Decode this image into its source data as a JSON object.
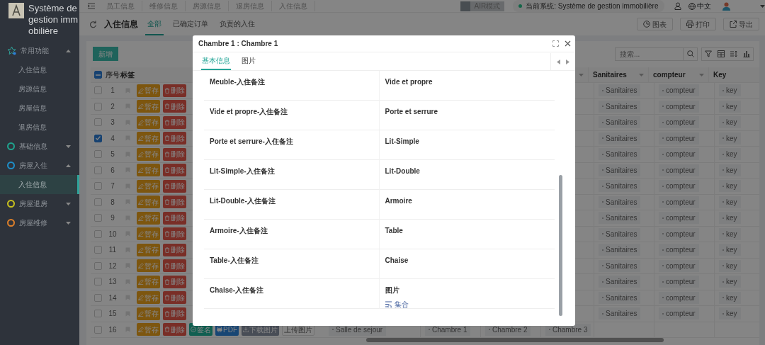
{
  "sidebar": {
    "title": "Système de gestion immobilière",
    "menu": [
      {
        "label": "常用功能",
        "kind": "star",
        "expanded": true,
        "children": [
          {
            "label": "入住信息",
            "selected": false
          },
          {
            "label": "房源信息",
            "selected": false
          },
          {
            "label": "房屋信息",
            "selected": false
          },
          {
            "label": "退房信息",
            "selected": false
          }
        ]
      },
      {
        "label": "基础信息",
        "kind": "ring",
        "color": "#1fa58f",
        "expanded": false
      },
      {
        "label": "房屋入住",
        "kind": "ring",
        "color": "#1e8fc9",
        "expanded": true,
        "children": [
          {
            "label": "入住信息",
            "selected": true
          }
        ]
      },
      {
        "label": "房屋退房",
        "kind": "ring",
        "color": "#c9c21e",
        "expanded": false
      },
      {
        "label": "房屋维修",
        "kind": "ring",
        "color": "#e0812a",
        "expanded": false
      }
    ]
  },
  "top_tabs": [
    "员工信息",
    "维修信息",
    "房源信息",
    "退房信息",
    "入住信息"
  ],
  "air_mode": {
    "label": "AIR模式",
    "on": false
  },
  "current_system": "当前系统: Système de gestion immobilière",
  "language": "中文",
  "page": {
    "title": "入住信息",
    "tabs": [
      {
        "label": "全部",
        "selected": true
      },
      {
        "label": "已确定订单",
        "selected": false
      },
      {
        "label": "负责的入住",
        "selected": false
      }
    ],
    "actions": [
      "图表",
      "打印",
      "导出"
    ]
  },
  "toolbar": {
    "add": "新增",
    "search_placeholder": "搜索..."
  },
  "table": {
    "select_all_partial": true,
    "header_left": [
      "序号",
      "标签"
    ],
    "header_right": [
      {
        "label": "Sanitaires",
        "filter": true
      },
      {
        "label": "compteur",
        "filter": true
      },
      {
        "label": "Key",
        "filter": false
      }
    ],
    "rows": [
      {
        "number": "1",
        "checked": false,
        "actions": [
          {
            "kind": "save",
            "label": "暂存"
          },
          {
            "kind": "delete",
            "label": "删除"
          }
        ],
        "right_tags": [
          "Sanitaires",
          "compteur",
          "key"
        ]
      },
      {
        "number": "2",
        "checked": false,
        "actions": [
          {
            "kind": "save",
            "label": "暂存"
          },
          {
            "kind": "delete",
            "label": "删除"
          }
        ],
        "right_tags": [
          "Sanitaires",
          "compteur",
          "key"
        ]
      },
      {
        "number": "3",
        "checked": false,
        "actions": [
          {
            "kind": "save",
            "label": "暂存"
          },
          {
            "kind": "delete",
            "label": "删除"
          }
        ],
        "right_tags": [
          "Sanitaires",
          "compteur",
          "key"
        ]
      },
      {
        "number": "4",
        "checked": true,
        "actions": [
          {
            "kind": "save",
            "label": "暂存"
          },
          {
            "kind": "delete",
            "label": "删除"
          }
        ],
        "right_tags": [
          "Sanitaires",
          "compteur",
          "key"
        ]
      },
      {
        "number": "5",
        "checked": false,
        "actions": [
          {
            "kind": "save",
            "label": "暂存"
          },
          {
            "kind": "delete",
            "label": "删除"
          }
        ],
        "right_tags": [
          "Sanitaires",
          "compteur",
          "key"
        ]
      },
      {
        "number": "6",
        "checked": false,
        "actions": [
          {
            "kind": "save",
            "label": "暂存"
          },
          {
            "kind": "delete",
            "label": "删除"
          }
        ],
        "right_tags": [
          "Sanitaires",
          "compteur",
          "key"
        ]
      },
      {
        "number": "7",
        "checked": false,
        "actions": [
          {
            "kind": "save",
            "label": "暂存"
          },
          {
            "kind": "delete",
            "label": "删除"
          }
        ],
        "right_tags": [
          "Sanitaires",
          "compteur",
          "key"
        ]
      },
      {
        "number": "8",
        "checked": false,
        "actions": [
          {
            "kind": "save",
            "label": "暂存"
          },
          {
            "kind": "delete",
            "label": "删除"
          }
        ],
        "right_tags": [
          "Sanitaires",
          "compteur",
          "key"
        ]
      },
      {
        "number": "9",
        "checked": false,
        "actions": [
          {
            "kind": "save",
            "label": "暂存"
          },
          {
            "kind": "delete",
            "label": "删除"
          }
        ],
        "right_tags": [
          "Sanitaires",
          "compteur",
          "key"
        ]
      },
      {
        "number": "10",
        "checked": false,
        "actions": [
          {
            "kind": "save",
            "label": "暂存"
          },
          {
            "kind": "delete",
            "label": "删除"
          }
        ],
        "right_tags": [
          "Sanitaires",
          "compteur",
          "key"
        ]
      },
      {
        "number": "11",
        "checked": false,
        "actions": [
          {
            "kind": "save",
            "label": "暂存"
          },
          {
            "kind": "delete",
            "label": "删除"
          }
        ],
        "right_tags": [
          "Sanitaires",
          "compteur",
          "key"
        ]
      },
      {
        "number": "12",
        "checked": false,
        "actions": [
          {
            "kind": "save",
            "label": "暂存"
          },
          {
            "kind": "delete",
            "label": "删除"
          }
        ],
        "right_tags": [
          "Sanitaires",
          "compteur",
          "key"
        ]
      },
      {
        "number": "13",
        "checked": false,
        "actions": [
          {
            "kind": "save",
            "label": "暂存"
          },
          {
            "kind": "delete",
            "label": "删除"
          }
        ],
        "right_tags": [
          "Sanitaires",
          "compteur",
          "key"
        ]
      },
      {
        "number": "14",
        "checked": false,
        "actions": [
          {
            "kind": "save",
            "label": "暂存"
          },
          {
            "kind": "delete",
            "label": "删除"
          }
        ],
        "right_tags": [
          "Sanitaires",
          "compteur",
          "key"
        ]
      },
      {
        "number": "15",
        "checked": false,
        "actions": [
          {
            "kind": "save",
            "label": "暂存"
          },
          {
            "kind": "delete",
            "label": "删除"
          }
        ],
        "right_tags": [
          "Sanitaires",
          "compteur",
          "key"
        ]
      },
      {
        "number": "16",
        "checked": false,
        "actions": [
          {
            "kind": "save",
            "label": "暂存"
          },
          {
            "kind": "delete",
            "label": "删除"
          },
          {
            "kind": "sign",
            "label": "签名"
          },
          {
            "kind": "pdf",
            "label": "PDF"
          },
          {
            "kind": "download",
            "label": "下载图片"
          },
          {
            "kind": "upload",
            "label": "上传图片"
          }
        ],
        "middle_tags": [
          "Salle de sejour",
          "Chambre 1",
          "Chambre 2",
          "Chambre 3"
        ]
      }
    ]
  },
  "modal": {
    "title": "Chambre 1 : Chambre 1",
    "tabs": [
      {
        "label": "基本信息",
        "selected": true
      },
      {
        "label": "图片",
        "selected": false
      }
    ],
    "fields": [
      {
        "label": "Meuble-入住备注"
      },
      {
        "label": "Vide et propre"
      },
      {
        "label": "Vide et propre-入住备注"
      },
      {
        "label": "Porte et serrure"
      },
      {
        "label": "Porte et serrure-入住备注"
      },
      {
        "label": "Lit-Simple"
      },
      {
        "label": "Lit-Simple-入住备注"
      },
      {
        "label": "Lit-Double"
      },
      {
        "label": "Lit-Double-入住备注"
      },
      {
        "label": "Armoire"
      },
      {
        "label": "Armoire-入住备注"
      },
      {
        "label": "Table"
      },
      {
        "label": "Table-入住备注"
      },
      {
        "label": "Chaise"
      },
      {
        "label": "Chaise-入住备注"
      },
      {
        "label": "图片",
        "link": "集合"
      }
    ]
  }
}
